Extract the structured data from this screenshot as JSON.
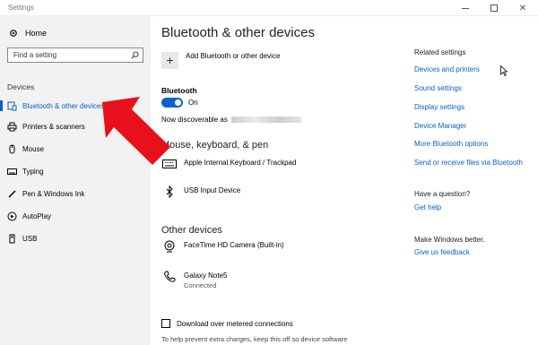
{
  "window": {
    "title": "Settings"
  },
  "sidebar": {
    "home_label": "Home",
    "search_placeholder": "Find a setting",
    "section": "Devices",
    "items": [
      {
        "label": "Bluetooth & other devices",
        "icon": "bluetooth-devices-icon",
        "active": true
      },
      {
        "label": "Printers & scanners",
        "icon": "printer-icon"
      },
      {
        "label": "Mouse",
        "icon": "mouse-icon"
      },
      {
        "label": "Typing",
        "icon": "keyboard-icon"
      },
      {
        "label": "Pen & Windows Ink",
        "icon": "pen-icon"
      },
      {
        "label": "AutoPlay",
        "icon": "autoplay-icon"
      },
      {
        "label": "USB",
        "icon": "usb-icon"
      }
    ]
  },
  "main": {
    "title": "Bluetooth & other devices",
    "add_device_label": "Add Bluetooth or other device",
    "bluetooth_label": "Bluetooth",
    "toggle_state": "On",
    "discoverable_prefix": "Now discoverable as",
    "mouse_keyboard_heading": "Mouse, keyboard, & pen",
    "input_devices": [
      {
        "name": "Apple Internal Keyboard / Trackpad",
        "icon": "keyboard-icon"
      },
      {
        "name": "USB Input Device",
        "icon": "bluetooth-icon"
      }
    ],
    "other_heading": "Other devices",
    "other_devices": [
      {
        "name": "FaceTime HD Camera (Built-in)",
        "icon": "webcam-icon",
        "status": ""
      },
      {
        "name": "Galaxy Note5",
        "icon": "phone-icon",
        "status": "Connected"
      }
    ],
    "metered_label": "Download over metered connections",
    "metered_help": "To help prevent extra charges, keep this off so device software"
  },
  "related": {
    "heading": "Related settings",
    "links": [
      "Devices and printers",
      "Sound settings",
      "Display settings",
      "Device Manager",
      "More Bluetooth options",
      "Send or receive files via Bluetooth"
    ],
    "question_heading": "Have a question?",
    "question_link": "Get help",
    "better_heading": "Make Windows better.",
    "better_link": "Give us feedback"
  },
  "colors": {
    "accent": "#0a5fc2",
    "toggle": "#0a64c8",
    "arrow": "#e8101a",
    "sidebar_bg": "#f2f2f2"
  }
}
